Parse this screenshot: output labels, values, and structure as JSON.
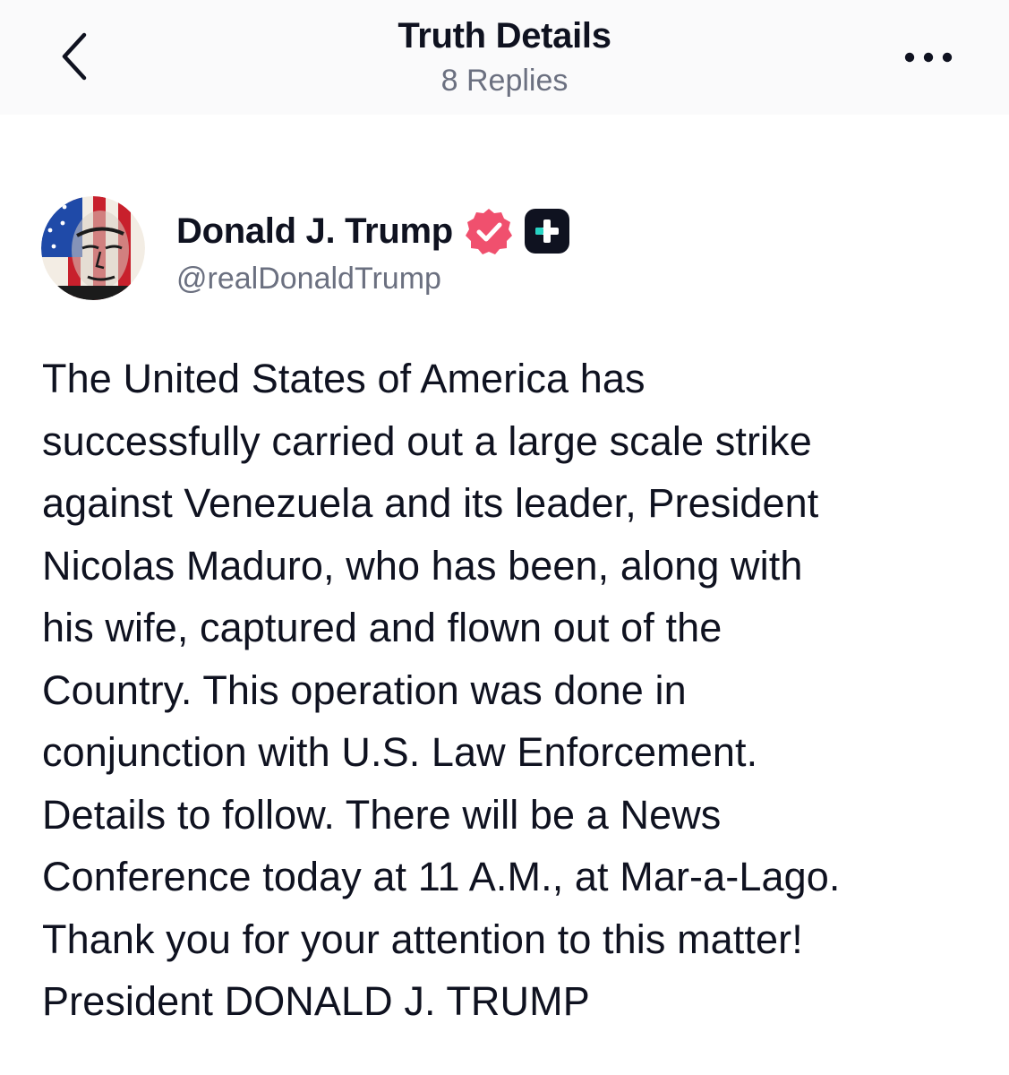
{
  "header": {
    "title": "Truth Details",
    "replies_label": "8 Replies"
  },
  "icons": {
    "back": "chevron-left-icon",
    "more": "more-horizontal-icon",
    "verified": "verified-badge-icon",
    "plus": "truth-plus-icon"
  },
  "colors": {
    "verified_badge": "#f0506e",
    "plus_badge": "#0f1220",
    "plus_accent": "#27d3c3",
    "muted_text": "#6b7080"
  },
  "post": {
    "author_name": "Donald J. Trump",
    "handle": "@realDonaldTrump",
    "body_lines": [
      "The United States of America has",
      "successfully carried out a large scale strike",
      "against Venezuela and its leader, President",
      "Nicolas Maduro, who has been, along with",
      "his wife, captured and flown out of the",
      "Country. This operation was done in",
      "conjunction with U.S. Law Enforcement.",
      "Details to follow. There will be a News",
      "Conference today at 11 A.M., at Mar-a-Lago.",
      "Thank you for your attention to this matter!",
      "President DONALD J. TRUMP"
    ]
  }
}
